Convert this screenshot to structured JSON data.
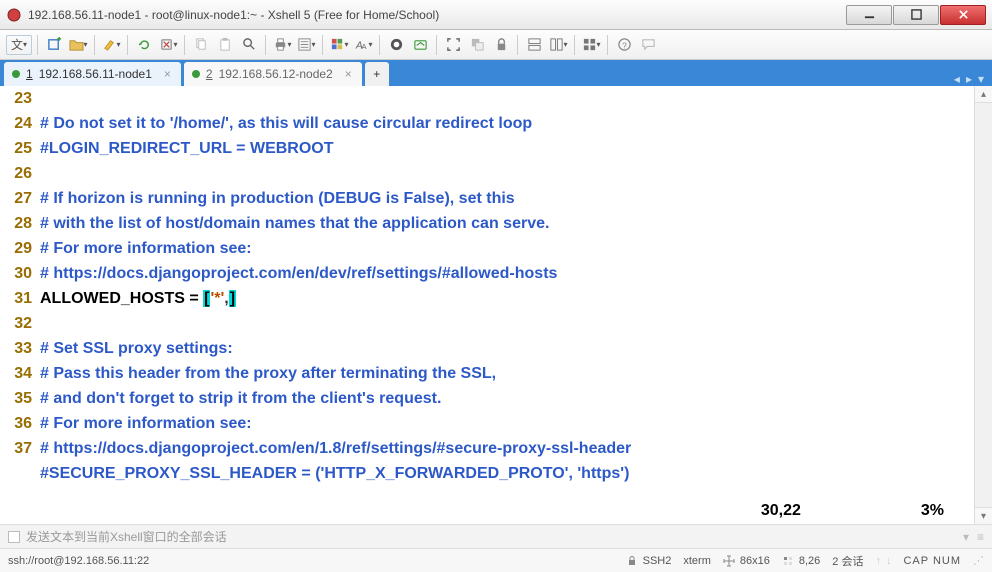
{
  "window": {
    "title": "192.168.56.11-node1 - root@linux-node1:~ - Xshell 5 (Free for Home/School)"
  },
  "tabs": {
    "t1": {
      "num": "1",
      "label": "192.168.56.11-node1"
    },
    "t2": {
      "num": "2",
      "label": "192.168.56.12-node2"
    },
    "new": "+"
  },
  "code": {
    "gutter": [
      "23",
      "24",
      "25",
      "26",
      "27",
      "28",
      "29",
      "30",
      "31",
      "32",
      "33",
      "34",
      "35",
      "36",
      "37"
    ],
    "l23": "# Do not set it to '/home/', as this will cause circular redirect loop",
    "l24": "#LOGIN_REDIRECT_URL = WEBROOT",
    "l25": "",
    "l26": "# If horizon is running in production (DEBUG is False), set this",
    "l27": "# with the list of host/domain names that the application can serve.",
    "l28": "# For more information see:",
    "l29": "# https://docs.djangoproject.com/en/dev/ref/settings/#allowed-hosts",
    "l30_ident": "ALLOWED_HOSTS",
    "l30_eq": " = ",
    "l30_lb": "[",
    "l30_str": "'*'",
    "l30_comma": ",",
    "l30_rb": "]",
    "l31": "",
    "l32": "# Set SSL proxy settings:",
    "l33": "# Pass this header from the proxy after terminating the SSL,",
    "l34": "# and don't forget to strip it from the client's request.",
    "l35": "# For more information see:",
    "l36": "# https://docs.djangoproject.com/en/1.8/ref/settings/#secure-proxy-ssl-header",
    "l37": "#SECURE_PROXY_SSL_HEADER = ('HTTP_X_FORWARDED_PROTO', 'https')"
  },
  "vim": {
    "pos": "30,22",
    "pct": "3%"
  },
  "broadcast": {
    "text": "发送文本到当前Xshell窗口的全部会话"
  },
  "status": {
    "conn": "ssh://root@192.168.56.11:22",
    "proto": "SSH2",
    "term": "xterm",
    "size": "86x16",
    "cursor": "8,26",
    "sessions": "2 会话",
    "caps": "CAP NUM"
  },
  "toolbar": {
    "wen": "文"
  }
}
